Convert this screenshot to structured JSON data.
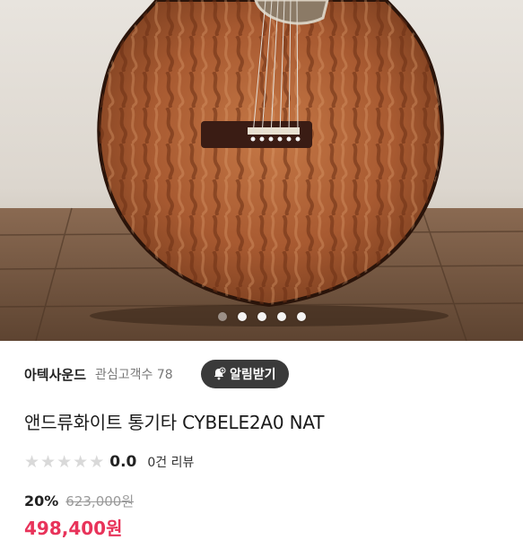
{
  "gallery": {
    "image_icon": "acoustic-guitar-photo",
    "slide_count": 5,
    "active_slide": 1
  },
  "seller": {
    "name": "아텍사운드",
    "followers_label": "관심고객수 78",
    "alarm_label": "알림받기",
    "alarm_icon": "bell-plus-icon"
  },
  "product": {
    "title": "앤드류화이트 통기타 CYBELE2A0 NAT"
  },
  "rating": {
    "stars_filled": 0,
    "stars_total": 5,
    "value": "0.0",
    "reviews_label": "0건 리뷰"
  },
  "price": {
    "discount": "20%",
    "original": "623,000원",
    "sale": "498,400원",
    "sale_color": "#e8335a"
  }
}
